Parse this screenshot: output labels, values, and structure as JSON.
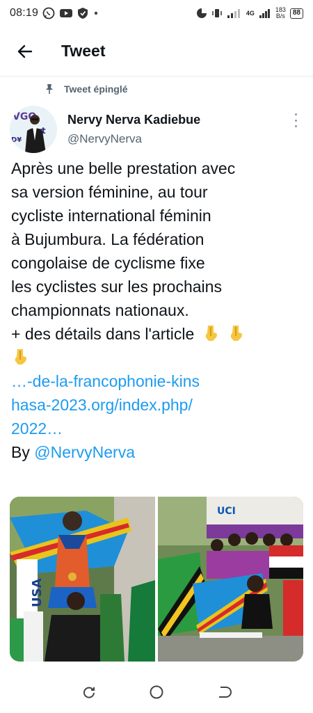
{
  "status_bar": {
    "time": "08:19",
    "network_label": "4G",
    "speed_value": "183",
    "speed_unit": "B/s",
    "battery": "88"
  },
  "header": {
    "title": "Tweet"
  },
  "pinned": {
    "label": "Tweet épinglé"
  },
  "author": {
    "name": "Nervy Nerva Kadiebue",
    "handle": "@NervyNerva"
  },
  "tweet": {
    "lines": [
      "Après une belle prestation avec",
      "sa version féminine, au tour",
      "cycliste international féminin",
      "à Bujumbura. La fédération",
      "congolaise de cyclisme fixe",
      "les cyclistes sur les prochains",
      "championnats nationaux.",
      "+ des détails dans l'article"
    ],
    "link_lines": [
      "…-de-la-francophonie-kins",
      "hasa-2023.org/index.php/",
      "2022…"
    ],
    "by_label": "By",
    "by_mention": "@NervyNerva"
  },
  "icons": {
    "back": "arrow-left-icon",
    "pin": "pin-icon",
    "more": "more-vertical-icon",
    "emoji": "pointing-down-emoji",
    "nav_recent": "recent-apps-icon",
    "nav_home": "home-icon",
    "nav_back": "back-nav-icon"
  },
  "colors": {
    "link": "#1d9bf0",
    "secondary_text": "#536471",
    "primary_text": "#0f1419",
    "divider": "#e6e9ea"
  }
}
